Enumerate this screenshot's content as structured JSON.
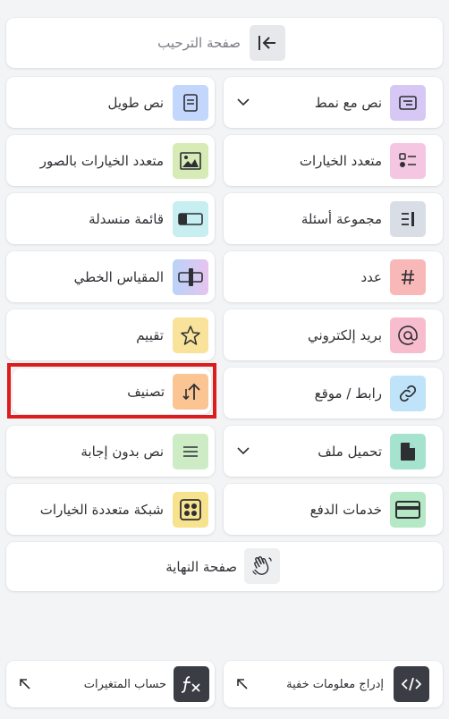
{
  "welcome_page": {
    "label": "صفحة الترحيب",
    "icon": "collapse-arrow-icon"
  },
  "items": {
    "text_with_style": {
      "label": "نص مع نمط",
      "icon": "styled-text-icon",
      "color": "#d6c7f5"
    },
    "long_text": {
      "label": "نص طويل",
      "icon": "document-icon",
      "color": "#c3d6fb"
    },
    "multiple_choice": {
      "label": "متعدد الخيارات",
      "icon": "choice-list-icon",
      "color": "#f5c6e2"
    },
    "image_choice": {
      "label": "متعدد الخيارات بالصور",
      "icon": "image-icon",
      "color": "#d6ebb5"
    },
    "question_group": {
      "label": "مجموعة أسئلة",
      "icon": "question-group-icon",
      "color": "#d9dde6"
    },
    "dropdown": {
      "label": "قائمة منسدلة",
      "icon": "dropdown-icon",
      "color": "#c7eef0"
    },
    "number": {
      "label": "عدد",
      "icon": "hash-icon",
      "color": "#f9b8b8"
    },
    "linear_scale": {
      "label": "المقياس الخطي",
      "icon": "linear-scale-icon",
      "color": "#c9dcf7"
    },
    "email": {
      "label": "بريد إلكتروني",
      "icon": "at-icon",
      "color": "#f7bdcf"
    },
    "rating": {
      "label": "تقييم",
      "icon": "star-icon",
      "color": "#f9e39a"
    },
    "link": {
      "label": "رابط / موقع",
      "icon": "link-icon",
      "color": "#bfe4f9"
    },
    "ranking": {
      "label": "تصنيف",
      "icon": "sort-arrows-icon",
      "color": "#fbc493"
    },
    "file_upload": {
      "label": "تحميل ملف",
      "icon": "file-icon",
      "color": "#a6e3cf"
    },
    "no_answer_text": {
      "label": "نص بدون إجابة",
      "icon": "lines-icon",
      "color": "#cdecc5"
    },
    "payment": {
      "label": "خدمات الدفع",
      "icon": "credit-card-icon",
      "color": "#b5e8c5"
    },
    "choice_grid": {
      "label": "شبكة متعددة الخيارات",
      "icon": "grid-icon",
      "color": "#f7e38e"
    }
  },
  "end_page": {
    "label": "صفحة النهاية",
    "icon": "waving-hand-icon"
  },
  "footer": {
    "hidden_info": {
      "label": "إدراج معلومات خفية",
      "icon": "code-icon"
    },
    "variables": {
      "label": "حساب المتغيرات",
      "icon": "function-icon"
    }
  },
  "colors": {
    "highlight": "#dd1c1c",
    "dark_tile": "#3a3d44",
    "page_bg": "#f3f4f6"
  }
}
